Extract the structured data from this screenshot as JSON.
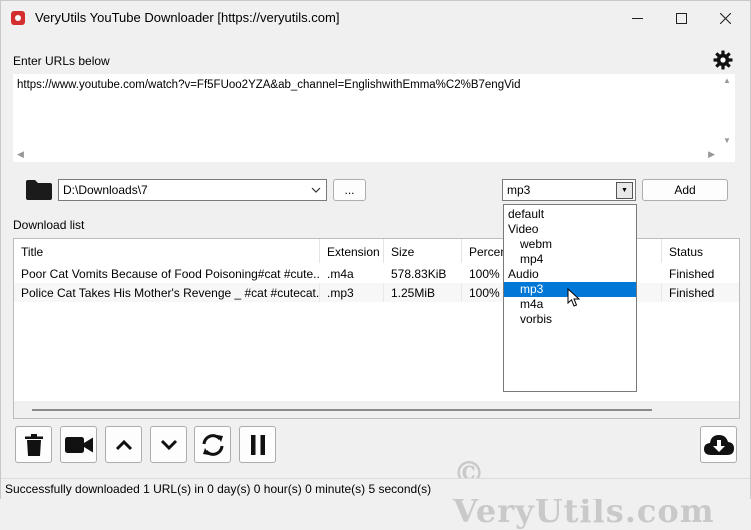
{
  "window": {
    "title": "VeryUtils YouTube Downloader [https://veryutils.com]"
  },
  "urls": {
    "label": "Enter URLs below",
    "value": "https://www.youtube.com/watch?v=Ff5FUoo2YZA&ab_channel=EnglishwithEmma%C2%B7engVid"
  },
  "path": {
    "value": "D:\\Downloads\\7",
    "browse_label": "..."
  },
  "format": {
    "selected": "mp3",
    "add_label": "Add",
    "options": [
      {
        "label": "default",
        "indent": 0
      },
      {
        "label": "Video",
        "indent": 0
      },
      {
        "label": "webm",
        "indent": 1
      },
      {
        "label": "mp4",
        "indent": 1
      },
      {
        "label": "Audio",
        "indent": 0
      },
      {
        "label": "mp3",
        "indent": 1,
        "selected": true
      },
      {
        "label": "m4a",
        "indent": 1
      },
      {
        "label": "vorbis",
        "indent": 1
      }
    ]
  },
  "download_list": {
    "label": "Download list",
    "columns": [
      "Title",
      "Extension",
      "Size",
      "Percen",
      "Status"
    ],
    "rows": [
      {
        "title": "Poor Cat Vomits Because of Food Poisoning#cat #cute...",
        "extension": ".m4a",
        "size": "578.83KiB",
        "percent": "100%",
        "status": "Finished"
      },
      {
        "title": "Police Cat Takes His Mother's Revenge _ #cat #cutecat...",
        "extension": ".mp3",
        "size": "1.25MiB",
        "percent": "100%",
        "status": "Finished"
      }
    ]
  },
  "toolbar": {
    "icons": [
      "trash-icon",
      "video-camera-icon",
      "move-up-icon",
      "move-down-icon",
      "refresh-icon",
      "pause-icon",
      "download-cloud-icon"
    ]
  },
  "status": {
    "text": "Successfully downloaded 1 URL(s) in 0 day(s) 0 hour(s) 0 minute(s) 5 second(s)"
  },
  "watermark": {
    "text": "© VeryUtils.com"
  }
}
